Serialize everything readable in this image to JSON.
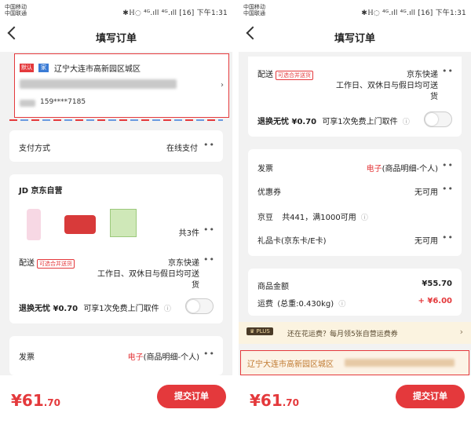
{
  "status": {
    "carrier_line1": "中国移动",
    "carrier_line2": "中国联通",
    "right": "✱ℍ◌ ⁴ᴳ.ıll ⁴ᴳ.ıll [16] 下午1:31"
  },
  "nav": {
    "title": "填写订单"
  },
  "address": {
    "tag_default": "默认",
    "tag_home": "家",
    "region": "辽宁大连市高新园区城区",
    "phone": "159****7185"
  },
  "payment": {
    "label": "支付方式",
    "value": "在线支付"
  },
  "store": {
    "name": "JD 京东自营",
    "count": "共3件"
  },
  "delivery": {
    "label": "配送",
    "merge_tag": "可选合并送货",
    "carrier": "京东快递",
    "time_line1": "工作日、双休日与假日均可送",
    "time_line2": "货"
  },
  "return_ins": {
    "label": "退换无忧 ¥0.70",
    "desc": "可享1次免费上门取件"
  },
  "invoice": {
    "label": "发票",
    "value_red": "电子",
    "value_rest": "(商品明细-个人)"
  },
  "coupon": {
    "label": "优惠券",
    "value": "无可用"
  },
  "jingdou": {
    "label": "京豆",
    "desc": "共441，满1000可用"
  },
  "giftcard": {
    "label": "礼品卡(京东卡/E卡)",
    "value": "无可用"
  },
  "summary": {
    "amount_label": "商品金额",
    "amount_value": "¥55.70",
    "shipping_label": "运费",
    "shipping_weight": "(总重:0.430kg)",
    "shipping_value": "+ ¥6.00"
  },
  "plus": {
    "badge": "PLUS",
    "text": "还在花运费？每月领5张自营运费券"
  },
  "address_bar": {
    "text": "辽宁大连市高新园区城区"
  },
  "footer": {
    "price_int": "¥61",
    "price_dec": ".70",
    "submit_label": "提交订单"
  },
  "colors": {
    "accent": "#e4393c",
    "plus_bg": "#fbf3e0",
    "plus_badge": "#4a3a27"
  }
}
